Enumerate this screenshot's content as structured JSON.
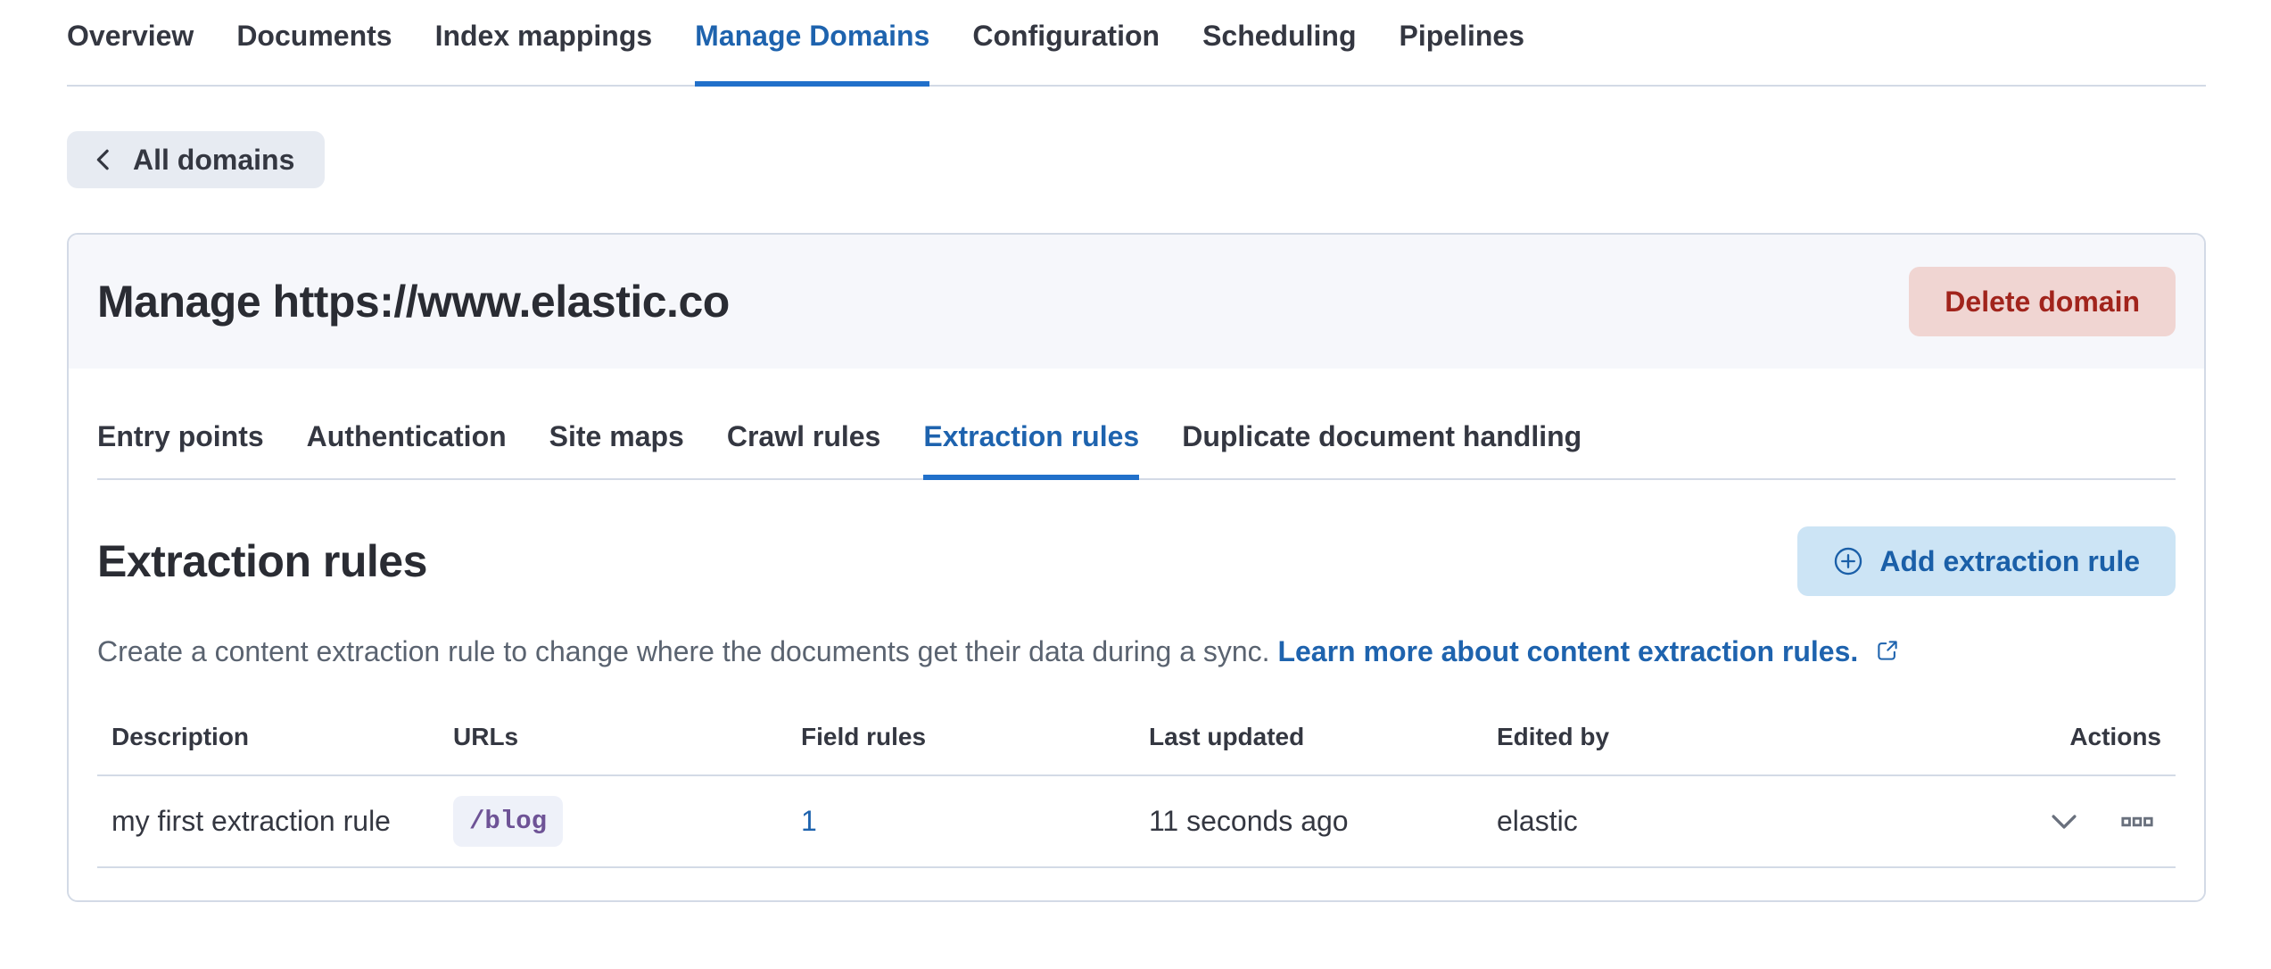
{
  "colors": {
    "active_tab_text": "#1E63AE",
    "active_tab_underline": "#2170CA",
    "link_blue": "#1E63AE",
    "danger_text": "#A1241C",
    "danger_button_bg": "#F0D5D2",
    "primary_button_bg": "#CCE4F5",
    "primary_button_text": "#1A5FA8",
    "back_button_bg": "#E7EBF2",
    "panel_header_bg": "#F6F7FB",
    "border": "#D3DAE6",
    "code_badge_text": "#6E5396",
    "code_badge_bg": "#EEF1F9",
    "muted_text": "#5A6370",
    "icon_gray": "#69707D"
  },
  "top_nav": {
    "tabs": [
      {
        "label": "Overview",
        "active": false
      },
      {
        "label": "Documents",
        "active": false
      },
      {
        "label": "Index mappings",
        "active": false
      },
      {
        "label": "Manage Domains",
        "active": true
      },
      {
        "label": "Configuration",
        "active": false
      },
      {
        "label": "Scheduling",
        "active": false
      },
      {
        "label": "Pipelines",
        "active": false
      }
    ]
  },
  "back_button": {
    "label": "All domains",
    "icon": "chevron-left-icon"
  },
  "domain_panel": {
    "title": "Manage https://www.elastic.co",
    "delete_button_label": "Delete domain",
    "tabs": [
      {
        "label": "Entry points",
        "active": false
      },
      {
        "label": "Authentication",
        "active": false
      },
      {
        "label": "Site maps",
        "active": false
      },
      {
        "label": "Crawl rules",
        "active": false
      },
      {
        "label": "Extraction rules",
        "active": true
      },
      {
        "label": "Duplicate document handling",
        "active": false
      }
    ],
    "section": {
      "title": "Extraction rules",
      "add_button_label": "Add extraction rule",
      "add_button_icon": "plus-in-circle-icon",
      "description": "Create a content extraction rule to change where the documents get their data during a sync.",
      "learn_more_link": "Learn more about content extraction rules.",
      "learn_more_icon": "external-link-icon"
    },
    "table": {
      "headers": [
        "Description",
        "URLs",
        "Field rules",
        "Last updated",
        "Edited by",
        "Actions"
      ],
      "rows": [
        {
          "description": "my first extraction rule",
          "url": "/blog",
          "field_rules": "1",
          "last_updated": "11 seconds ago",
          "edited_by": "elastic",
          "action_icons": [
            "chevron-down-icon",
            "boxes-horizontal-icon"
          ]
        }
      ]
    }
  }
}
